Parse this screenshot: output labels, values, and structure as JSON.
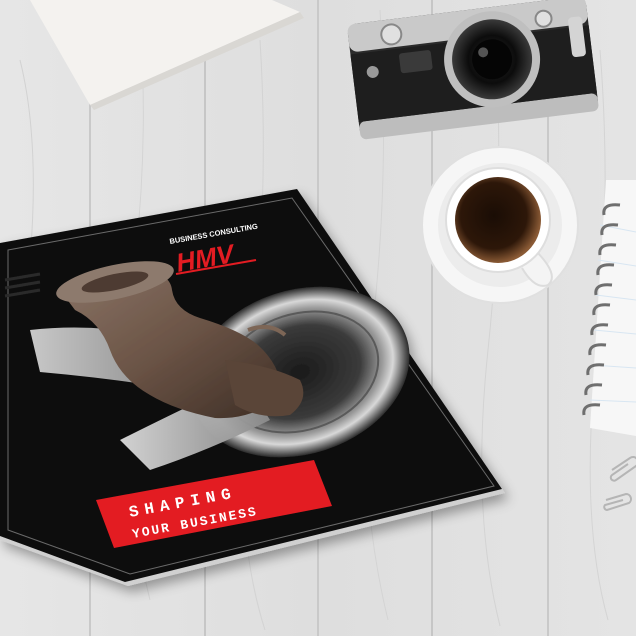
{
  "brochure": {
    "logo_caption": "BUSINESS CONSULTING",
    "logo_letters": "HMV",
    "headline_line1": "SHAPING",
    "headline_line2": "YOUR BUSINESS"
  },
  "colors": {
    "wood_base": "#e3e3e3",
    "brochure_dark": "#121212",
    "accent_red": "#e31b23",
    "clay_brown": "#6d5648",
    "coffee": "#3a2110"
  }
}
